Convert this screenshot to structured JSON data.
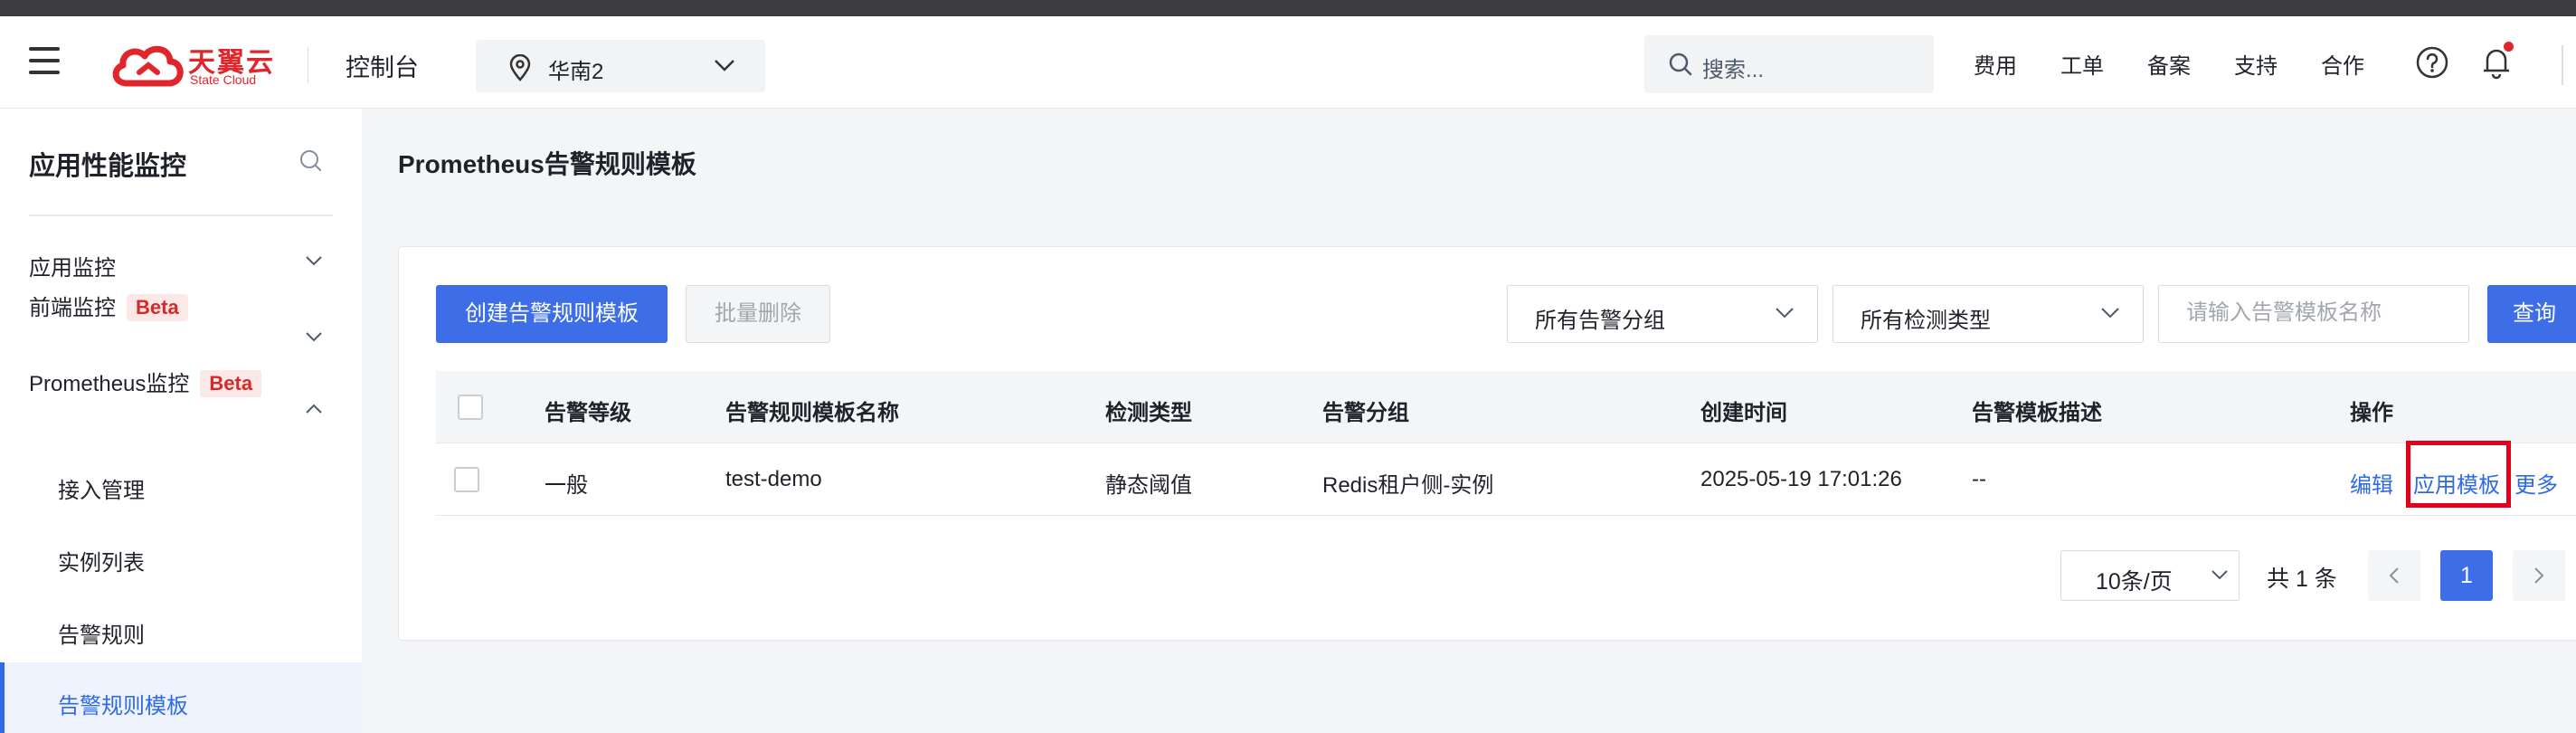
{
  "header": {
    "logo_cn": "天翼云",
    "logo_en": "State Cloud",
    "console_label": "控制台",
    "region": "华南2",
    "search_placeholder": "搜索...",
    "nav": [
      "费用",
      "工单",
      "备案",
      "支持",
      "合作"
    ],
    "brand_color": "#e0262b"
  },
  "sidebar": {
    "title": "应用性能监控",
    "items": [
      {
        "label": "应用监控",
        "badge": ""
      },
      {
        "label": "前端监控",
        "badge": "Beta"
      },
      {
        "label": "Prometheus监控",
        "badge": "Beta"
      }
    ],
    "sub_items": [
      "接入管理",
      "实例列表",
      "告警规则",
      "告警规则模板"
    ],
    "active_item": "告警规则模板"
  },
  "main": {
    "page_title": "Prometheus告警规则模板",
    "toolbar": {
      "create_label": "创建告警规则模板",
      "batch_delete_label": "批量删除",
      "group_select": "所有告警分组",
      "type_select": "所有检测类型",
      "name_placeholder": "请输入告警模板名称",
      "query_label": "查询"
    },
    "table": {
      "columns": [
        "告警等级",
        "告警规则模板名称",
        "检测类型",
        "告警分组",
        "创建时间",
        "告警模板描述",
        "操作"
      ],
      "rows": [
        {
          "level": "一般",
          "name": "test-demo",
          "detect_type": "静态阈值",
          "group": "Redis租户侧-实例",
          "created": "2025-05-19 17:01:26",
          "description": "--",
          "actions": [
            "编辑",
            "应用模板",
            "更多"
          ]
        }
      ]
    },
    "pagination": {
      "page_size": "10条/页",
      "total": "共 1 条",
      "current_page": "1"
    },
    "accent_color": "#3d6ee8"
  }
}
